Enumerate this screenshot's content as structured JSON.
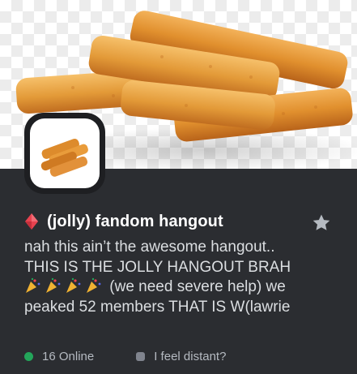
{
  "server": {
    "name": "(jolly) fandom hangout",
    "badge_icon": "gem-icon",
    "badge_color": "#e8424f",
    "favorite_icon": "star-icon"
  },
  "description": {
    "line1": "nah this ain’t the awesome hangout..",
    "line2": "THIS IS THE JOLLY HANGOUT BRAH",
    "line3_emojis": "party-popper-icon x4",
    "line3_text": " (we need severe help) we",
    "line4": "peaked 52 members THAT IS W(lawrie"
  },
  "stats": {
    "online_label": "16 Online",
    "online_color": "#23a55a",
    "members_label": "I feel distant?",
    "members_color": "#80848e"
  },
  "images": {
    "banner": "fish-sticks-banner",
    "avatar": "fish-sticks-avatar"
  }
}
